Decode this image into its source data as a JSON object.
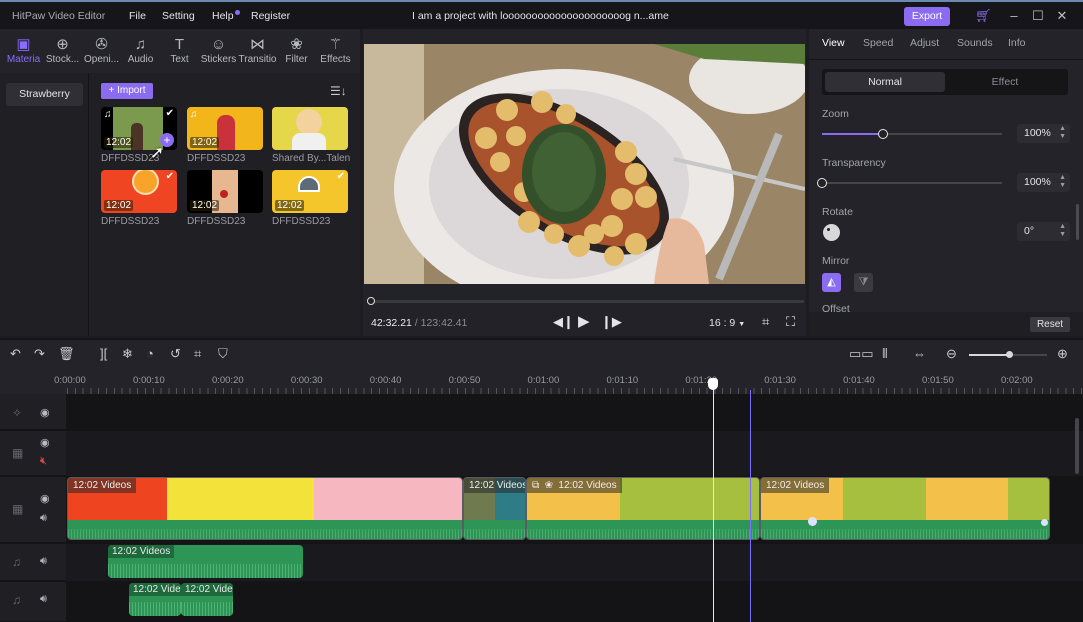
{
  "titlebar": {
    "app_name": "HitPaw Video Editor",
    "menu": [
      "File",
      "Setting",
      "Help",
      "Register"
    ],
    "project_name": "I am a project with looooooooooooooooooooog n...ame",
    "export_label": "Export",
    "icons": [
      "cart-icon",
      "minimize-icon",
      "maximize-icon",
      "close-icon"
    ]
  },
  "media_tabs": [
    {
      "label": "Materia",
      "icon": "▶",
      "active": true
    },
    {
      "label": "Stock...",
      "icon": "⊕"
    },
    {
      "label": "Openi...",
      "icon": "✇"
    },
    {
      "label": "Audio",
      "icon": "♫"
    },
    {
      "label": "Text",
      "icon": "T"
    },
    {
      "label": "Stickers",
      "icon": "☺"
    },
    {
      "label": "Transitio",
      "icon": "⋈"
    },
    {
      "label": "Filter",
      "icon": "❀"
    },
    {
      "label": "Effects",
      "icon": "✨"
    }
  ],
  "library": {
    "folders": [
      "Strawberry"
    ],
    "import_label": "+ Import",
    "items": [
      {
        "name": "DFFDSSD23",
        "duration": "12:02",
        "audio": true,
        "checked": true,
        "hovered": true
      },
      {
        "name": "DFFDSSD23",
        "duration": "12:02",
        "audio": true,
        "checked": false
      },
      {
        "name": "Shared By...Talen",
        "duration": "",
        "audio": false,
        "checked": false
      },
      {
        "name": "DFFDSSD23",
        "duration": "12:02",
        "audio": false,
        "checked": true
      },
      {
        "name": "DFFDSSD23",
        "duration": "12:02",
        "audio": false,
        "checked": false
      },
      {
        "name": "DFFDSSD23",
        "duration": "12:02",
        "audio": false,
        "checked": true
      }
    ]
  },
  "preview": {
    "current_time": "42:32.21",
    "total_time": "/ 123:42.41",
    "progress": 0.0,
    "aspect": "16 : 9",
    "controls": [
      "prev-frame",
      "play",
      "next-frame",
      "crop",
      "fullscreen"
    ]
  },
  "properties": {
    "tabs": [
      "View",
      "Speed",
      "Adjust",
      "Sounds",
      "Info"
    ],
    "active_tab": "View",
    "mode": [
      "Normal",
      "Effect"
    ],
    "zoom_label": "Zoom",
    "zoom_value": "100%",
    "zoom_slider_fraction": 0.34,
    "transparency_label": "Transparency",
    "transparency_value": "100%",
    "transparency_slider_fraction": 0.0,
    "rotate_label": "Rotate",
    "rotate_value": "0°",
    "mirror_label": "Mirror",
    "offset_label": "Offset",
    "reset_label": "Reset"
  },
  "timeline": {
    "toolbar_left": [
      "undo-icon",
      "redo-icon",
      "delete-icon",
      "split-icon",
      "freeze-icon",
      "speed-icon",
      "history-icon",
      "crop-icon",
      "mask-icon"
    ],
    "toolbar_right": [
      "detach-icon",
      "split-center-icon",
      "fit-icon",
      "zoom-out-icon",
      "zoom-in-icon"
    ],
    "zoom_fraction": 0.5,
    "ruler": [
      "0:00:00",
      "0:00:10",
      "0:00:20",
      "0:00:30",
      "0:00:40",
      "0:00:50",
      "0:01:00",
      "0:01:10",
      "0:01:20",
      "0:01:30",
      "0:01:40",
      "0:01:50",
      "0:02:00"
    ],
    "video_clips": [
      {
        "label": "12:02  Videos"
      },
      {
        "label": "12:02  Videos"
      },
      {
        "label": "12:02  Videos"
      },
      {
        "label": "12:02  Videos"
      }
    ],
    "audio_clips": [
      {
        "label": "12:02  Videos"
      },
      {
        "label": "12:02  Vide"
      },
      {
        "label": "12:02  Vide"
      }
    ]
  },
  "colors": {
    "accent": "#8b6cf0",
    "audio": "#2d9556"
  }
}
